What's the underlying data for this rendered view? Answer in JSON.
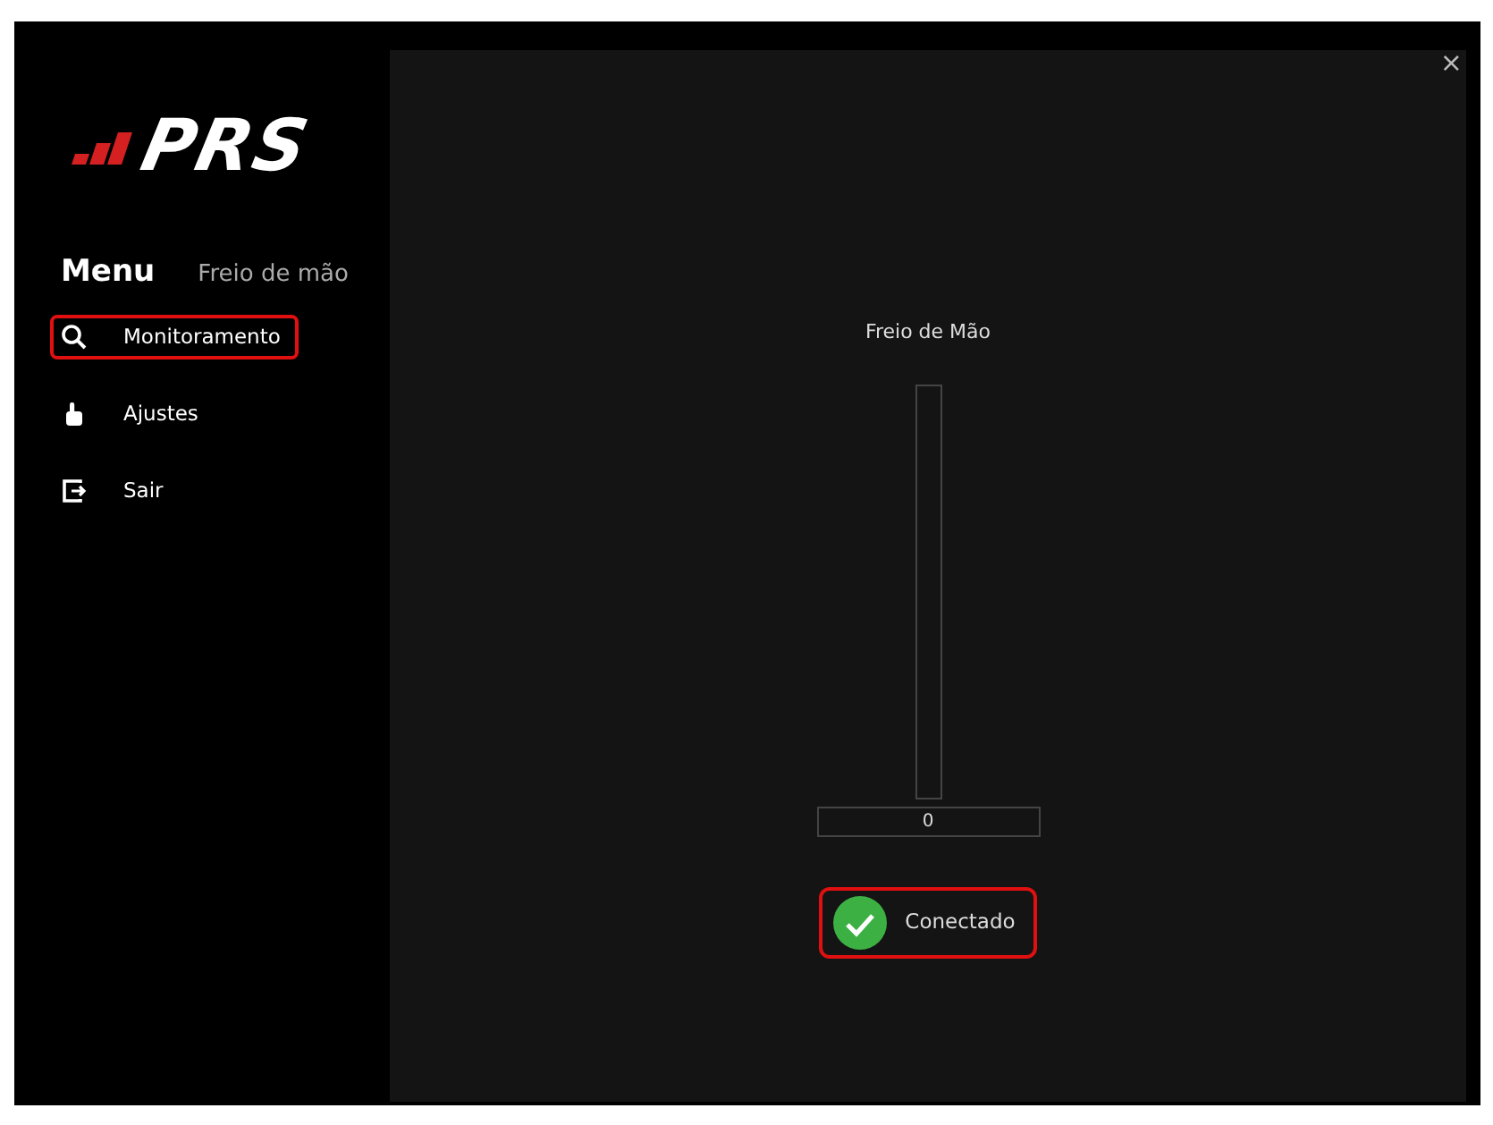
{
  "logo": {
    "text": "PRS"
  },
  "sidebar": {
    "title": "Menu",
    "subtitle": "Freio de mão",
    "items": [
      {
        "label": "Monitoramento",
        "kind": "search",
        "selected": true
      },
      {
        "label": "Ajustes",
        "kind": "hand",
        "selected": false
      },
      {
        "label": "Sair",
        "kind": "exit",
        "selected": false
      }
    ]
  },
  "window": {
    "close": "×"
  },
  "gauge": {
    "title": "Freio de Mão",
    "level": 0,
    "reading": "0"
  },
  "status": {
    "label": "Conectado",
    "connected": true,
    "highlighted": true
  }
}
